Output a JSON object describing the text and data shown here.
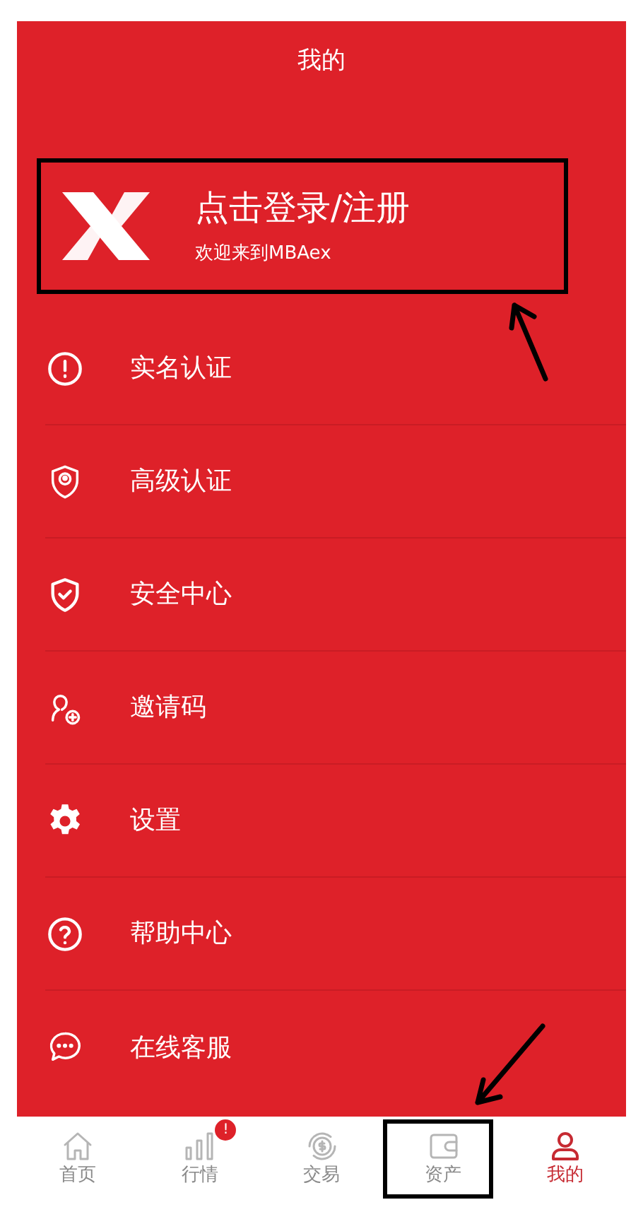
{
  "header": {
    "title": "我的"
  },
  "login": {
    "title": "点击登录/注册",
    "subtitle": "欢迎来到MBAex"
  },
  "menu": [
    {
      "kind": "alert",
      "label": "实名认证"
    },
    {
      "kind": "shield-user",
      "label": "高级认证"
    },
    {
      "kind": "shield-check",
      "label": "安全中心"
    },
    {
      "kind": "user-plus",
      "label": "邀请码"
    },
    {
      "kind": "gear",
      "label": "设置"
    },
    {
      "kind": "help",
      "label": "帮助中心"
    },
    {
      "kind": "chat",
      "label": "在线客服"
    }
  ],
  "tabs": [
    {
      "kind": "home",
      "label": "首页",
      "selected": false
    },
    {
      "kind": "chart",
      "label": "行情",
      "selected": false,
      "badge": "!"
    },
    {
      "kind": "exchange",
      "label": "交易",
      "selected": false
    },
    {
      "kind": "wallet",
      "label": "资产",
      "selected": false
    },
    {
      "kind": "user",
      "label": "我的",
      "selected": true
    }
  ]
}
